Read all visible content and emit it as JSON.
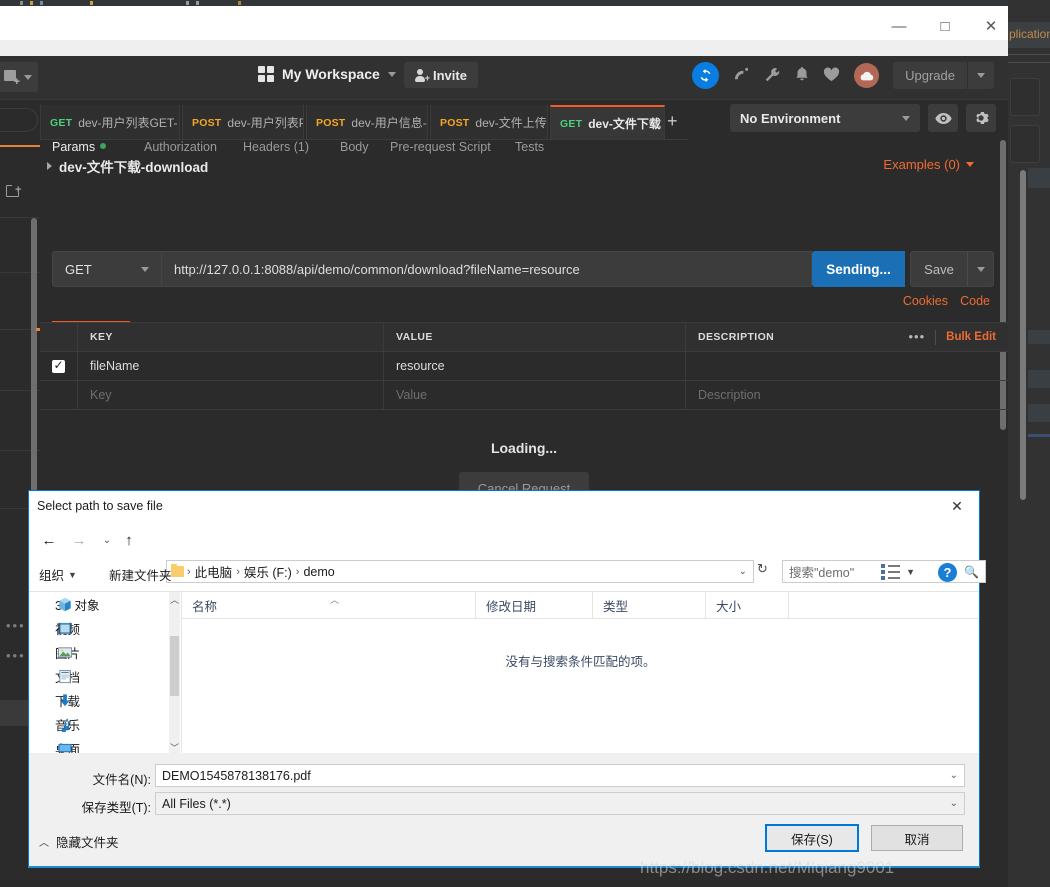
{
  "window": {
    "minimize": "—",
    "maximize": "□",
    "close": "✕",
    "background_app_text": "plication"
  },
  "postman": {
    "header": {
      "new_button": "New",
      "workspace_name": "My Workspace",
      "invite_label": "Invite",
      "upgrade_label": "Upgrade",
      "icons": [
        "sync-icon",
        "antenna-icon",
        "wrench-icon",
        "bell-icon",
        "heart-icon",
        "cloud-avatar"
      ]
    },
    "environment": {
      "selected": "No Environment",
      "eye_icon": "eye-icon",
      "gear_icon": "gear-icon"
    },
    "tabs": [
      {
        "method": "GET",
        "name": "dev-用户列表GET-",
        "active": false
      },
      {
        "method": "POST",
        "name": "dev-用户列表POS",
        "active": false
      },
      {
        "method": "POST",
        "name": "dev-用户信息-inf",
        "active": false
      },
      {
        "method": "POST",
        "name": "dev-文件上传-up",
        "active": false
      },
      {
        "method": "GET",
        "name": "dev-文件下载",
        "active": true
      }
    ],
    "tab_add": "+",
    "tab_more": "•••",
    "breadcrumb": "dev-文件下载-download",
    "examples_label": "Examples (0)",
    "request": {
      "method": "GET",
      "url": "http://127.0.0.1:8088/api/demo/common/download?fileName=resource",
      "send_label": "Sending...",
      "save_label": "Save"
    },
    "req_tabs": [
      {
        "label": "Params",
        "active": true,
        "dot": true
      },
      {
        "label": "Authorization",
        "active": false,
        "dot": false
      },
      {
        "label": "Headers (1)",
        "active": false,
        "dot": false
      },
      {
        "label": "Body",
        "active": false,
        "dot": false
      },
      {
        "label": "Pre-request Script",
        "active": false,
        "dot": false
      },
      {
        "label": "Tests",
        "active": false,
        "dot": false
      }
    ],
    "cookies_label": "Cookies",
    "code_label": "Code",
    "params": {
      "headers": {
        "key": "KEY",
        "value": "VALUE",
        "description": "DESCRIPTION"
      },
      "bulk_edit": "Bulk Edit",
      "more_dots": "•••",
      "rows": [
        {
          "checked": true,
          "key": "fileName",
          "value": "resource",
          "description": ""
        }
      ],
      "placeholder_row": {
        "key": "Key",
        "value": "Value",
        "description": "Description"
      }
    },
    "response": {
      "loading": "Loading...",
      "cancel_label": "Cancel Request"
    }
  },
  "dialog": {
    "title": "Select path to save file",
    "close": "✕",
    "nav": {
      "back": "←",
      "forward": "→",
      "recent": "⌄",
      "up": "↑",
      "refresh": "↻"
    },
    "breadcrumb": [
      "此电脑",
      "娱乐 (F:)",
      "demo"
    ],
    "search_placeholder": "搜索\"demo\"",
    "toolbar": {
      "organize": "组织",
      "new_folder": "新建文件夹",
      "help": "?"
    },
    "nav_pane": [
      {
        "label": "3D 对象",
        "icon": "3d-object-icon"
      },
      {
        "label": "视频",
        "icon": "video-icon"
      },
      {
        "label": "图片",
        "icon": "picture-icon"
      },
      {
        "label": "文档",
        "icon": "document-icon"
      },
      {
        "label": "下载",
        "icon": "download-icon"
      },
      {
        "label": "音乐",
        "icon": "music-icon"
      },
      {
        "label": "桌面",
        "icon": "desktop-icon"
      }
    ],
    "columns": [
      "名称",
      "修改日期",
      "类型",
      "大小"
    ],
    "empty_message": "没有与搜索条件匹配的项。",
    "fields": {
      "filename_label": "文件名(N):",
      "filename_value": "DEMO1545878138176.pdf",
      "filetype_label": "保存类型(T):",
      "filetype_value": "All Files (*.*)"
    },
    "hide_folders": "隐藏文件夹",
    "save_button": "保存(S)",
    "cancel_button": "取消"
  },
  "watermark": "https://blog.csdn.net/Mlqiang9001",
  "colors": {
    "accent_orange": "#ef5b25",
    "send_blue": "#1a6fb5",
    "get_green": "#4dd07c",
    "post_orange": "#f5a623",
    "dialog_blue": "#0078d7"
  }
}
